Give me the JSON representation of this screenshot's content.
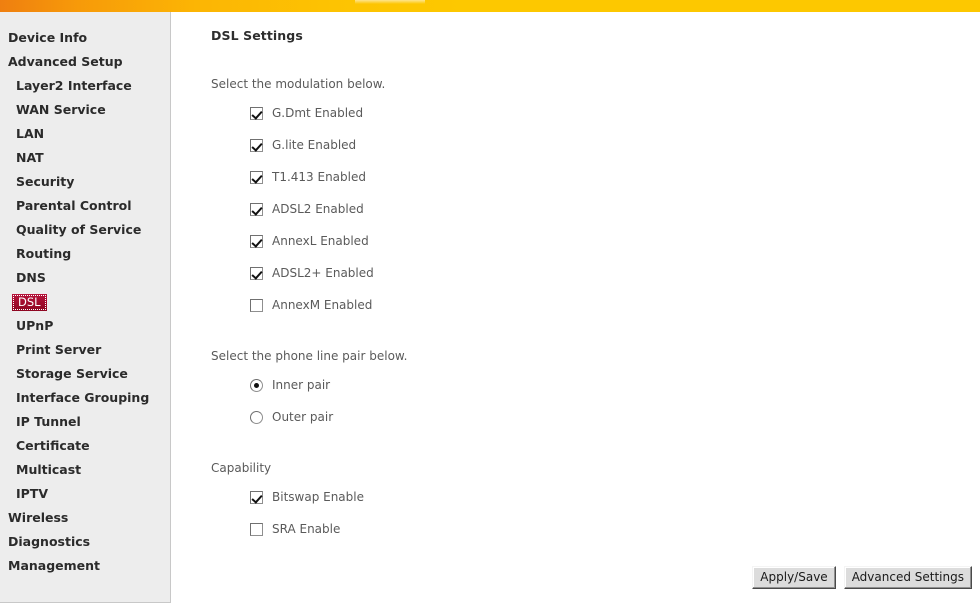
{
  "banner": {
    "accent_left": "#ef7f10",
    "accent_right": "#fdc800"
  },
  "sidebar": {
    "selected_color": "#9e0b2a",
    "items": [
      {
        "label": "Device Info",
        "level": 0,
        "selected": false
      },
      {
        "label": "Advanced Setup",
        "level": 0,
        "selected": false
      },
      {
        "label": "Layer2 Interface",
        "level": 1,
        "selected": false
      },
      {
        "label": "WAN Service",
        "level": 1,
        "selected": false
      },
      {
        "label": "LAN",
        "level": 1,
        "selected": false
      },
      {
        "label": "NAT",
        "level": 1,
        "selected": false
      },
      {
        "label": "Security",
        "level": 1,
        "selected": false
      },
      {
        "label": "Parental Control",
        "level": 1,
        "selected": false
      },
      {
        "label": "Quality of Service",
        "level": 1,
        "selected": false
      },
      {
        "label": "Routing",
        "level": 1,
        "selected": false
      },
      {
        "label": "DNS",
        "level": 1,
        "selected": false
      },
      {
        "label": "DSL",
        "level": 1,
        "selected": true
      },
      {
        "label": "UPnP",
        "level": 1,
        "selected": false
      },
      {
        "label": "Print Server",
        "level": 1,
        "selected": false
      },
      {
        "label": "Storage Service",
        "level": 1,
        "selected": false
      },
      {
        "label": "Interface Grouping",
        "level": 1,
        "selected": false
      },
      {
        "label": "IP Tunnel",
        "level": 1,
        "selected": false
      },
      {
        "label": "Certificate",
        "level": 1,
        "selected": false
      },
      {
        "label": "Multicast",
        "level": 1,
        "selected": false
      },
      {
        "label": "IPTV",
        "level": 1,
        "selected": false
      },
      {
        "label": "Wireless",
        "level": 0,
        "selected": false
      },
      {
        "label": "Diagnostics",
        "level": 0,
        "selected": false
      },
      {
        "label": "Management",
        "level": 0,
        "selected": false
      }
    ]
  },
  "main": {
    "title": "DSL Settings",
    "modulation": {
      "label": "Select the modulation below.",
      "options": [
        {
          "label": "G.Dmt Enabled",
          "checked": true
        },
        {
          "label": "G.lite Enabled",
          "checked": true
        },
        {
          "label": "T1.413 Enabled",
          "checked": true
        },
        {
          "label": "ADSL2 Enabled",
          "checked": true
        },
        {
          "label": "AnnexL Enabled",
          "checked": true
        },
        {
          "label": "ADSL2+ Enabled",
          "checked": true
        },
        {
          "label": "AnnexM Enabled",
          "checked": false
        }
      ]
    },
    "phone_line": {
      "label": "Select the phone line pair below.",
      "options": [
        {
          "label": "Inner pair",
          "checked": true
        },
        {
          "label": "Outer pair",
          "checked": false
        }
      ]
    },
    "capability": {
      "label": "Capability",
      "options": [
        {
          "label": "Bitswap Enable",
          "checked": true
        },
        {
          "label": "SRA Enable",
          "checked": false
        }
      ]
    }
  },
  "buttons": {
    "apply_save": "Apply/Save",
    "advanced_settings": "Advanced Settings"
  }
}
